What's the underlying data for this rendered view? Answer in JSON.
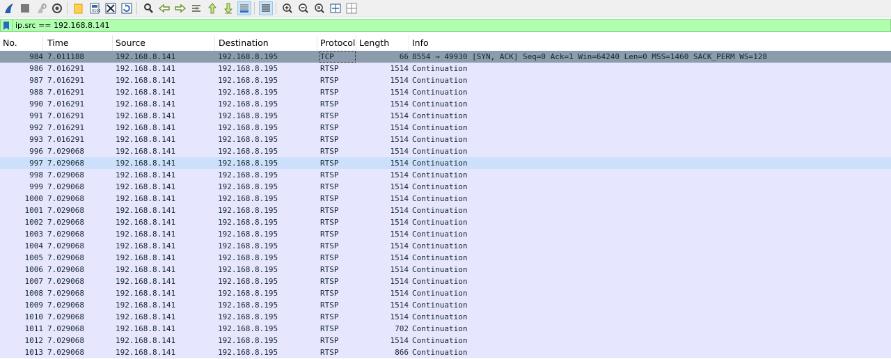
{
  "toolbar": {
    "icons": [
      "shark-fin-start-icon",
      "stop-capture-icon",
      "restart-capture-icon",
      "capture-options-icon",
      "open-file-icon",
      "save-file-icon",
      "close-file-icon",
      "reload-file-icon",
      "find-packet-icon",
      "go-back-icon",
      "go-forward-icon",
      "go-to-packet-icon",
      "go-first-packet-icon",
      "go-last-packet-icon",
      "auto-scroll-icon",
      "colorize-icon",
      "zoom-in-icon",
      "zoom-out-icon",
      "zoom-normal-icon",
      "resize-columns-icon",
      "layout-icon"
    ]
  },
  "filter": {
    "value": "ip.src == 192.168.8.141",
    "background": "#afffaf"
  },
  "columns": [
    "No.",
    "Time",
    "Source",
    "Destination",
    "Protocol",
    "Length",
    "Info"
  ],
  "rows": [
    {
      "no": "984",
      "time": "7.011188",
      "src": "192.168.8.141",
      "dst": "192.168.8.195",
      "proto": "TCP",
      "len": "66",
      "info": "8554 → 49930 [SYN, ACK] Seq=0 Ack=1 Win=64240 Len=0 MSS=1460 SACK_PERM WS=128"
    },
    {
      "no": "986",
      "time": "7.016291",
      "src": "192.168.8.141",
      "dst": "192.168.8.195",
      "proto": "RTSP",
      "len": "1514",
      "info": "Continuation"
    },
    {
      "no": "987",
      "time": "7.016291",
      "src": "192.168.8.141",
      "dst": "192.168.8.195",
      "proto": "RTSP",
      "len": "1514",
      "info": "Continuation"
    },
    {
      "no": "988",
      "time": "7.016291",
      "src": "192.168.8.141",
      "dst": "192.168.8.195",
      "proto": "RTSP",
      "len": "1514",
      "info": "Continuation"
    },
    {
      "no": "990",
      "time": "7.016291",
      "src": "192.168.8.141",
      "dst": "192.168.8.195",
      "proto": "RTSP",
      "len": "1514",
      "info": "Continuation"
    },
    {
      "no": "991",
      "time": "7.016291",
      "src": "192.168.8.141",
      "dst": "192.168.8.195",
      "proto": "RTSP",
      "len": "1514",
      "info": "Continuation"
    },
    {
      "no": "992",
      "time": "7.016291",
      "src": "192.168.8.141",
      "dst": "192.168.8.195",
      "proto": "RTSP",
      "len": "1514",
      "info": "Continuation"
    },
    {
      "no": "993",
      "time": "7.016291",
      "src": "192.168.8.141",
      "dst": "192.168.8.195",
      "proto": "RTSP",
      "len": "1514",
      "info": "Continuation"
    },
    {
      "no": "996",
      "time": "7.029068",
      "src": "192.168.8.141",
      "dst": "192.168.8.195",
      "proto": "RTSP",
      "len": "1514",
      "info": "Continuation"
    },
    {
      "no": "997",
      "time": "7.029068",
      "src": "192.168.8.141",
      "dst": "192.168.8.195",
      "proto": "RTSP",
      "len": "1514",
      "info": "Continuation"
    },
    {
      "no": "998",
      "time": "7.029068",
      "src": "192.168.8.141",
      "dst": "192.168.8.195",
      "proto": "RTSP",
      "len": "1514",
      "info": "Continuation"
    },
    {
      "no": "999",
      "time": "7.029068",
      "src": "192.168.8.141",
      "dst": "192.168.8.195",
      "proto": "RTSP",
      "len": "1514",
      "info": "Continuation"
    },
    {
      "no": "1000",
      "time": "7.029068",
      "src": "192.168.8.141",
      "dst": "192.168.8.195",
      "proto": "RTSP",
      "len": "1514",
      "info": "Continuation"
    },
    {
      "no": "1001",
      "time": "7.029068",
      "src": "192.168.8.141",
      "dst": "192.168.8.195",
      "proto": "RTSP",
      "len": "1514",
      "info": "Continuation"
    },
    {
      "no": "1002",
      "time": "7.029068",
      "src": "192.168.8.141",
      "dst": "192.168.8.195",
      "proto": "RTSP",
      "len": "1514",
      "info": "Continuation"
    },
    {
      "no": "1003",
      "time": "7.029068",
      "src": "192.168.8.141",
      "dst": "192.168.8.195",
      "proto": "RTSP",
      "len": "1514",
      "info": "Continuation"
    },
    {
      "no": "1004",
      "time": "7.029068",
      "src": "192.168.8.141",
      "dst": "192.168.8.195",
      "proto": "RTSP",
      "len": "1514",
      "info": "Continuation"
    },
    {
      "no": "1005",
      "time": "7.029068",
      "src": "192.168.8.141",
      "dst": "192.168.8.195",
      "proto": "RTSP",
      "len": "1514",
      "info": "Continuation"
    },
    {
      "no": "1006",
      "time": "7.029068",
      "src": "192.168.8.141",
      "dst": "192.168.8.195",
      "proto": "RTSP",
      "len": "1514",
      "info": "Continuation"
    },
    {
      "no": "1007",
      "time": "7.029068",
      "src": "192.168.8.141",
      "dst": "192.168.8.195",
      "proto": "RTSP",
      "len": "1514",
      "info": "Continuation"
    },
    {
      "no": "1008",
      "time": "7.029068",
      "src": "192.168.8.141",
      "dst": "192.168.8.195",
      "proto": "RTSP",
      "len": "1514",
      "info": "Continuation"
    },
    {
      "no": "1009",
      "time": "7.029068",
      "src": "192.168.8.141",
      "dst": "192.168.8.195",
      "proto": "RTSP",
      "len": "1514",
      "info": "Continuation"
    },
    {
      "no": "1010",
      "time": "7.029068",
      "src": "192.168.8.141",
      "dst": "192.168.8.195",
      "proto": "RTSP",
      "len": "1514",
      "info": "Continuation"
    },
    {
      "no": "1011",
      "time": "7.029068",
      "src": "192.168.8.141",
      "dst": "192.168.8.195",
      "proto": "RTSP",
      "len": "702",
      "info": "Continuation"
    },
    {
      "no": "1012",
      "time": "7.029068",
      "src": "192.168.8.141",
      "dst": "192.168.8.195",
      "proto": "RTSP",
      "len": "1514",
      "info": "Continuation"
    },
    {
      "no": "1013",
      "time": "7.029068",
      "src": "192.168.8.141",
      "dst": "192.168.8.195",
      "proto": "RTSP",
      "len": "866",
      "info": "Continuation"
    }
  ],
  "selected_row": "984",
  "hover_row": "997",
  "colors": {
    "row_bg": "#e7e6ff",
    "selected_bg": "#8b9cad",
    "hover_bg": "#cce0fb",
    "text": "#12272e"
  }
}
